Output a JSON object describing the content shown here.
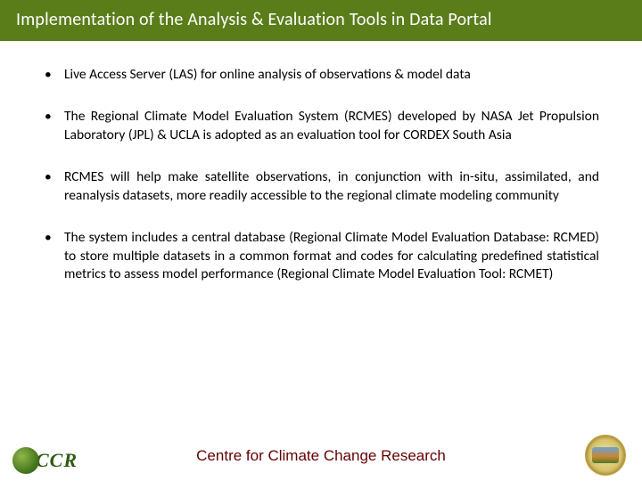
{
  "title": "Implementation of the Analysis & Evaluation Tools in Data Portal",
  "bullets": [
    "Live Access Server (LAS)  for online analysis of observations & model data",
    "The Regional Climate Model Evaluation System (RCMES) developed by NASA Jet Propulsion Laboratory (JPL) & UCLA is adopted as an evaluation tool for CORDEX South Asia",
    "RCMES will help make satellite observations, in conjunction with in-situ, assimilated, and reanalysis datasets, more readily accessible to the regional climate modeling community",
    "The system includes a central database (Regional Climate Model Evaluation Database: RCMED) to store multiple datasets in a common format and codes for calculating predefined statistical metrics to assess model performance (Regional Climate Model Evaluation Tool: RCMET)"
  ],
  "footer": "Centre for Climate Change Research",
  "logo_left_letters": "CCR"
}
